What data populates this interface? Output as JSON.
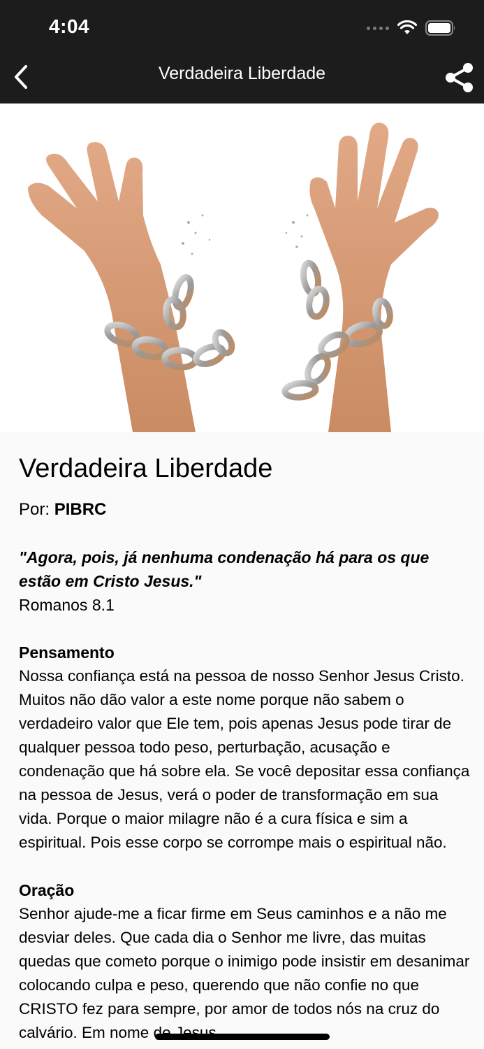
{
  "status_bar": {
    "time": "4:04"
  },
  "nav": {
    "title": "Verdadeira Liberdade",
    "back_icon": "chevron-left-icon",
    "share_icon": "share-icon"
  },
  "hero": {
    "image_description": "hands-breaking-chains"
  },
  "article": {
    "title": "Verdadeira Liberdade",
    "author_prefix": "Por: ",
    "author_name": "PIBRC",
    "verse": "\"Agora, pois, já nenhuma condenação há para os que estão em Cristo Jesus.\"",
    "verse_ref": "Romanos 8.1",
    "thought_heading": "Pensamento",
    "thought_text": "Nossa confiança está na pessoa de nosso Senhor Jesus Cristo. Muitos não dão valor a este nome porque não sabem o verdadeiro valor que Ele tem, pois apenas Jesus pode tirar de qualquer pessoa todo peso, perturbação, acusação e condenação que há sobre ela. Se você depositar essa confiança na pessoa de Jesus, verá o poder de transformação em sua vida. Porque o maior milagre não é a cura física e sim a espiritual. Pois esse corpo se corrompe mais o espiritual não.",
    "prayer_heading": "Oração",
    "prayer_text": "Senhor ajude-me a ficar firme em Seus caminhos e a não me desviar deles. Que cada dia o Senhor me livre, das muitas quedas que cometo porque o inimigo pode insistir em desanimar colocando culpa e peso, querendo que não confie no que CRISTO fez para sempre, por amor de todos nós na cruz do calvário. Em nome de Jesus."
  },
  "colors": {
    "header_bg": "#1c1c1c",
    "page_bg": "#fafafa"
  }
}
